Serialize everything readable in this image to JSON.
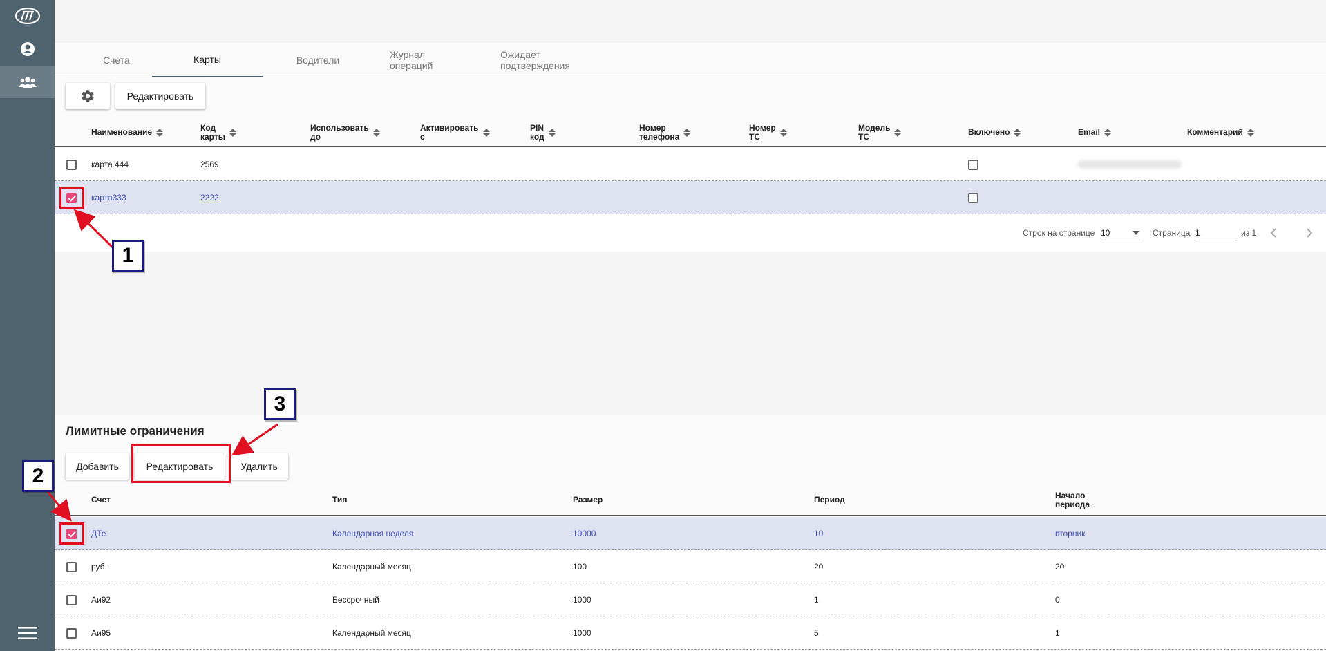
{
  "sidebar": {
    "icons": [
      "logo-icon",
      "account-icon",
      "clients-icon",
      "menu-icon"
    ]
  },
  "tabs": [
    {
      "label": "Счета",
      "active": false
    },
    {
      "label": "Карты",
      "active": true
    },
    {
      "label": "Водители",
      "active": false
    },
    {
      "label": "Журнал операций",
      "active": false
    },
    {
      "label": "Ожидает подтверждения",
      "active": false
    }
  ],
  "cards": {
    "edit_label": "Редактировать",
    "columns": [
      {
        "line1": "Наименование",
        "line2": ""
      },
      {
        "line1": "Код",
        "line2": "карты"
      },
      {
        "line1": "Использовать",
        "line2": "до"
      },
      {
        "line1": "Активировать",
        "line2": "с"
      },
      {
        "line1": "PIN",
        "line2": "код"
      },
      {
        "line1": "Номер",
        "line2": "телефона"
      },
      {
        "line1": "Номер",
        "line2": "ТС"
      },
      {
        "line1": "Модель",
        "line2": "ТС"
      },
      {
        "line1": "Включено",
        "line2": ""
      },
      {
        "line1": "Email",
        "line2": ""
      },
      {
        "line1": "Комментарий",
        "line2": ""
      }
    ],
    "rows": [
      {
        "name": "карта 444",
        "code": "2569",
        "selected": false
      },
      {
        "name": "карта333",
        "code": "2222",
        "selected": true
      }
    ],
    "pager": {
      "rows_per_page_label": "Строк на странице",
      "rows_per_page": "10",
      "page_label": "Страница",
      "page": "1",
      "of_label": "из 1"
    }
  },
  "limits": {
    "title": "Лимитные ограничения",
    "add_label": "Добавить",
    "edit_label": "Редактировать",
    "delete_label": "Удалить",
    "columns": [
      {
        "line1": "Счет",
        "line2": ""
      },
      {
        "line1": "Тип",
        "line2": ""
      },
      {
        "line1": "Размер",
        "line2": ""
      },
      {
        "line1": "Период",
        "line2": ""
      },
      {
        "line1": "Начало",
        "line2": "периода"
      }
    ],
    "rows": [
      {
        "account": "ДТе",
        "type": "Календарная неделя",
        "size": "10000",
        "period": "10",
        "start": "вторник",
        "selected": true
      },
      {
        "account": "руб.",
        "type": "Календарный месяц",
        "size": "100",
        "period": "20",
        "start": "20",
        "selected": false
      },
      {
        "account": "Аи92",
        "type": "Бессрочный",
        "size": "1000",
        "period": "1",
        "start": "0",
        "selected": false
      },
      {
        "account": "Аи95",
        "type": "Календарный месяц",
        "size": "1000",
        "period": "5",
        "start": "1",
        "selected": false
      }
    ]
  },
  "annotations": [
    "1",
    "2",
    "3"
  ],
  "colors": {
    "sidebar": "#4f636e",
    "selected_row": "#dfe3f1",
    "checkbox_on": "#e8457a",
    "callout_red": "#e01020",
    "badge_border": "#1a1a80",
    "link_blue": "#3f51b5"
  }
}
